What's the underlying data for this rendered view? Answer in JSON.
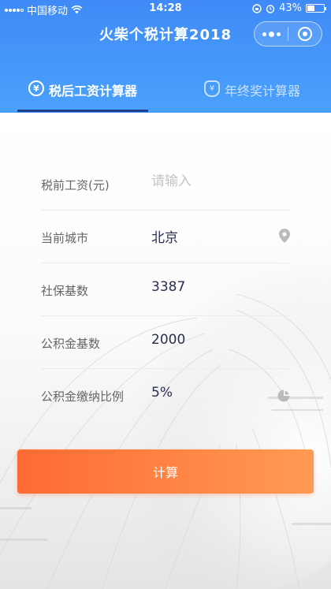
{
  "status_bar": {
    "carrier": "中国移动",
    "time": "14:28",
    "battery": "43%",
    "battery_level": 0.43
  },
  "navbar": {
    "title": "火柴个税计算2018"
  },
  "tabs": [
    {
      "label": "税后工资计算器",
      "icon": "yen-circle-icon",
      "active": true
    },
    {
      "label": "年终奖计算器",
      "icon": "money-bag-icon",
      "active": false
    }
  ],
  "form": {
    "salary": {
      "label": "税前工资(元)",
      "placeholder": "请输入",
      "value": ""
    },
    "city": {
      "label": "当前城市",
      "value": "北京",
      "icon": "location-pin-icon"
    },
    "social_base": {
      "label": "社保基数",
      "value": "3387"
    },
    "fund_base": {
      "label": "公积金基数",
      "value": "2000"
    },
    "fund_ratio": {
      "label": "公积金缴纳比例",
      "value": "5%",
      "icon": "pie-chart-icon"
    }
  },
  "calculate_button": {
    "label": "计算"
  },
  "colors": {
    "header_blue": "#4294f9",
    "tab_underline": "#1d3f8f",
    "button_orange": "#ff7a3d",
    "value_text": "#2a2f4f"
  }
}
